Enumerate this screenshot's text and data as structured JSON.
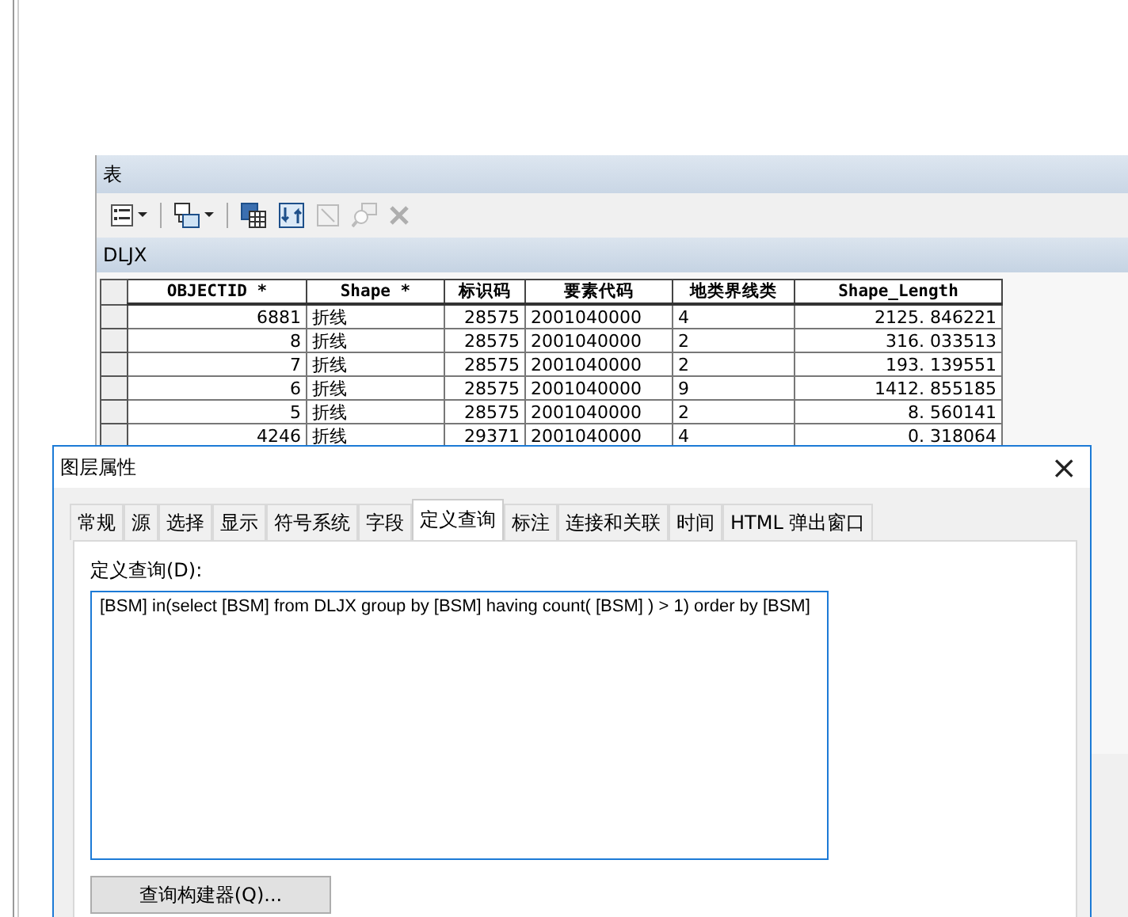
{
  "table_window": {
    "title": "表",
    "toolbar": [
      {
        "kind": "options",
        "dropdown": true,
        "disabled": false
      },
      {
        "kind": "relate",
        "dropdown": true,
        "disabled": false
      },
      {
        "kind": "select",
        "dropdown": false,
        "disabled": false
      },
      {
        "kind": "switch",
        "dropdown": false,
        "disabled": false
      },
      {
        "kind": "clear",
        "dropdown": false,
        "disabled": true
      },
      {
        "kind": "zoom",
        "dropdown": false,
        "disabled": true
      },
      {
        "kind": "delete",
        "dropdown": false,
        "disabled": true
      }
    ],
    "layer_tab": "DLJX",
    "table": {
      "columns": [
        "OBJECTID *",
        "Shape *",
        "标识码",
        "要素代码",
        "地类界线类",
        "Shape_Length"
      ],
      "rows": [
        [
          "6881",
          "折线",
          "28575",
          "2001040000",
          "4",
          "2125. 846221"
        ],
        [
          "8",
          "折线",
          "28575",
          "2001040000",
          "2",
          "316. 033513"
        ],
        [
          "7",
          "折线",
          "28575",
          "2001040000",
          "2",
          "193. 139551"
        ],
        [
          "6",
          "折线",
          "28575",
          "2001040000",
          "9",
          "1412. 855185"
        ],
        [
          "5",
          "折线",
          "28575",
          "2001040000",
          "2",
          "8. 560141"
        ],
        [
          "4246",
          "折线",
          "29371",
          "2001040000",
          "4",
          "0. 318064"
        ]
      ]
    }
  },
  "dialog": {
    "title": "图层属性",
    "close": "×",
    "tabs": [
      {
        "label": "常规",
        "selected": false
      },
      {
        "label": "源",
        "selected": false
      },
      {
        "label": "选择",
        "selected": false
      },
      {
        "label": "显示",
        "selected": false
      },
      {
        "label": "符号系统",
        "selected": false
      },
      {
        "label": "字段",
        "selected": false
      },
      {
        "label": "定义查询",
        "selected": true
      },
      {
        "label": "标注",
        "selected": false
      },
      {
        "label": "连接和关联",
        "selected": false
      },
      {
        "label": "时间",
        "selected": false
      },
      {
        "label": "HTML 弹出窗口",
        "selected": false
      }
    ],
    "query_label": "定义查询(D):",
    "query": "[BSM] in(select [BSM] from DLJX group by [BSM] having count( [BSM] ) > 1) order by [BSM]",
    "builder_button": "查询构建器(Q)..."
  }
}
